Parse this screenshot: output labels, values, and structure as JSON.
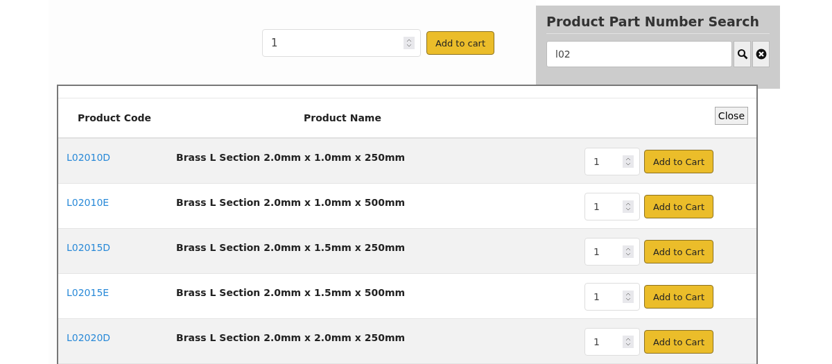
{
  "product_form": {
    "quantity": "1",
    "add_button": "Add to cart"
  },
  "search_panel": {
    "title": "Product Part Number Search",
    "query": "l02"
  },
  "results_modal": {
    "close_button": "Close",
    "columns": [
      "Product Code",
      "Product Name"
    ],
    "rows": [
      {
        "code": "L02010D",
        "name": "Brass L Section 2.0mm x 1.0mm x 250mm",
        "quantity": "1",
        "add_button": "Add to Cart"
      },
      {
        "code": "L02010E",
        "name": "Brass L Section 2.0mm x 1.0mm x 500mm",
        "quantity": "1",
        "add_button": "Add to Cart"
      },
      {
        "code": "L02015D",
        "name": "Brass L Section 2.0mm x 1.5mm x 250mm",
        "quantity": "1",
        "add_button": "Add to Cart"
      },
      {
        "code": "L02015E",
        "name": "Brass L Section 2.0mm x 1.5mm x 500mm",
        "quantity": "1",
        "add_button": "Add to Cart"
      },
      {
        "code": "L02020D",
        "name": "Brass L Section 2.0mm x 2.0mm x 250mm",
        "quantity": "1",
        "add_button": "Add to Cart"
      }
    ]
  }
}
